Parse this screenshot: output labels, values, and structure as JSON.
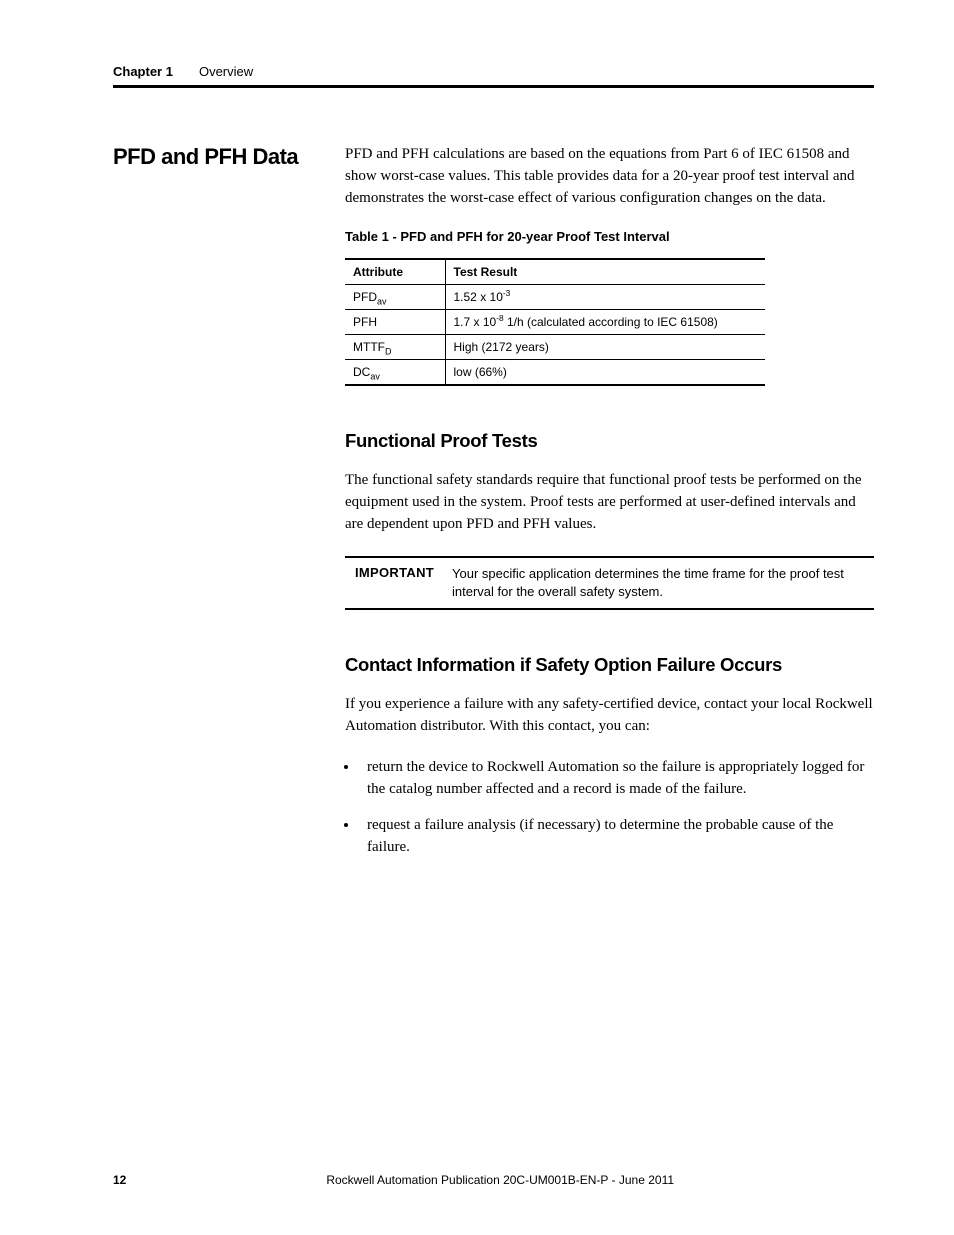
{
  "header": {
    "chapter": "Chapter 1",
    "title": "Overview"
  },
  "side_heading": "PFD and PFH Data",
  "intro_paragraph": "PFD and PFH calculations are based on the equations from Part 6 of IEC 61508 and show worst-case values. This table provides data for a 20-year proof test interval and demonstrates the worst-case effect of various configuration changes on the data.",
  "table": {
    "caption": "Table 1 - PFD and PFH for 20-year Proof Test Interval",
    "headers": {
      "col1": "Attribute",
      "col2": "Test Result"
    },
    "rows": [
      {
        "attr_base": "PFD",
        "attr_sub": "av",
        "result_pre": "1.52 x 10",
        "result_sup": "-3",
        "result_post": ""
      },
      {
        "attr_base": "PFH",
        "attr_sub": "",
        "result_pre": "1.7 x 10",
        "result_sup": "-8",
        "result_post": " 1/h (calculated according to IEC 61508)"
      },
      {
        "attr_base": "MTTF",
        "attr_sub": "D",
        "result_pre": "High (2172 years)",
        "result_sup": "",
        "result_post": ""
      },
      {
        "attr_base": "DC",
        "attr_sub": "av",
        "result_pre": "low (66%)",
        "result_sup": "",
        "result_post": ""
      }
    ]
  },
  "section1": {
    "heading": "Functional Proof Tests",
    "paragraph": "The functional safety standards require that functional proof tests be performed on the equipment used in the system. Proof tests are performed at user-defined intervals and are dependent upon PFD and PFH values.",
    "callout_label": "IMPORTANT",
    "callout_text": "Your specific application determines the time frame for the proof test interval for the overall safety system."
  },
  "section2": {
    "heading": "Contact Information if Safety Option Failure Occurs",
    "paragraph": "If you experience a failure with any safety-certified device, contact your local Rockwell Automation distributor. With this contact, you can:",
    "bullets": [
      "return the device to Rockwell Automation so the failure is appropriately logged for the catalog number affected and a record is made of the failure.",
      "request a failure analysis (if necessary) to determine the probable cause of the failure."
    ]
  },
  "footer": {
    "page": "12",
    "publication": "Rockwell Automation Publication 20C-UM001B-EN-P - June 2011"
  }
}
